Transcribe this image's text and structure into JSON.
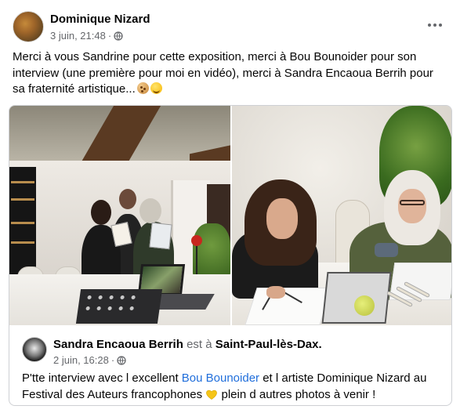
{
  "post": {
    "author": "Dominique Nizard",
    "date": "3 juin, 21:48",
    "dot": "·",
    "text": "Merci à vous Sandrine pour cette exposition, merci à Bou Bounoider pour son interview (une première pour moi en vidéo), merci à Sandra Encaoua Berrih pour sa fraternité artistique...",
    "emojis": [
      "cookie-icon",
      "smile-icon"
    ],
    "icons": {
      "privacy": "globe-icon",
      "more": "more-icon"
    }
  },
  "shared": {
    "author": "Sandra Encaoua Berrih",
    "at_text": "est à",
    "place": "Saint-Paul-lès-Dax.",
    "date": "2 juin, 16:28",
    "dot": "·",
    "text_before_link": "P'tte interview avec l excellent ",
    "link_text": "Bou Bounoider",
    "text_after_link": " et l artiste Dominique Nizard au Festival des Auteurs francophones",
    "text_end": " plein d autres photos à venir !",
    "emoji": "yellow-heart-icon",
    "link_color": "#216fdb"
  },
  "colors": {
    "text": "#050505",
    "muted": "#65676b",
    "border": "#ced0d4"
  }
}
